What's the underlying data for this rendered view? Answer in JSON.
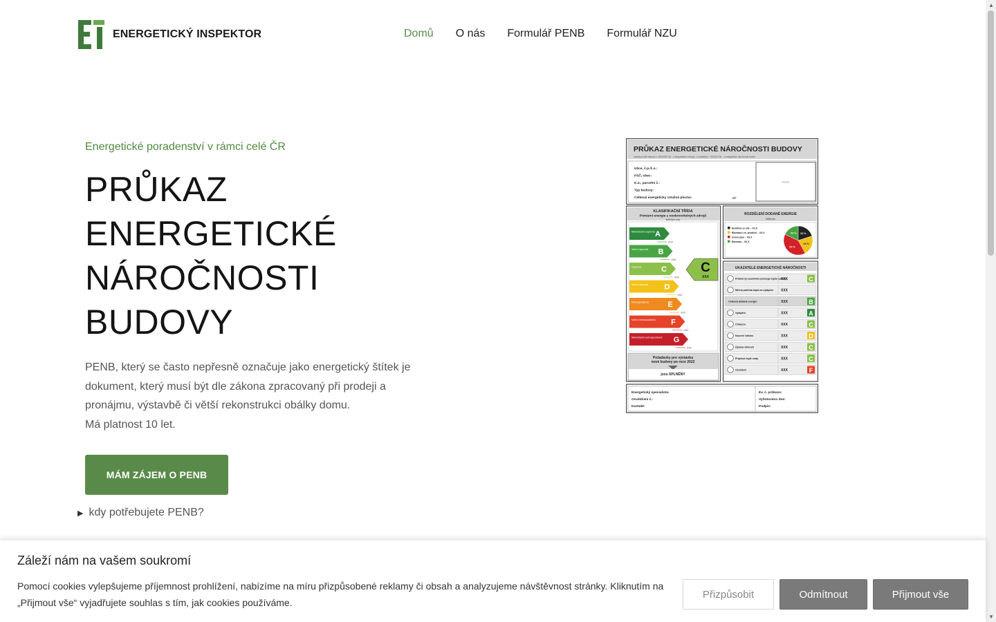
{
  "header": {
    "logo_text": "ENERGETICKÝ INSPEKTOR",
    "nav": [
      {
        "label": "Domů",
        "active": true
      },
      {
        "label": "O nás",
        "active": false
      },
      {
        "label": "Formulář PENB",
        "active": false
      },
      {
        "label": "Formulář NZU",
        "active": false
      }
    ]
  },
  "hero": {
    "kicker": "Energetické poradenství v rámci celé ČR",
    "title_lines": [
      "PRŮKAZ",
      "ENERGETICKÉ",
      "NÁROČNOSTI",
      "BUDOVY"
    ],
    "desc_lines": [
      "PENB, který se často nepřesně označuje jako energetický štítek je",
      "dokument, který musí být dle zákona zpracovaný při prodeji a",
      "pronájmu, výstavbě či větší rekonstrukci obálky domu.",
      "Má platnost 10 let."
    ],
    "cta_label": "MÁM ZÁJEM O PENB",
    "details_label": "kdy potřebujete PENB?"
  },
  "certificate": {
    "title": "PRŮKAZ ENERGETICKÉ NÁROČNOSTI BUDOVY",
    "subtitle": "vydaný podle zákona č. 406/2000 Sb., o hospodaření energií, a vyhlášky č. 78/2013 Sb., o energetické náročnosti budov",
    "fields": [
      "Ulice, č.p./č.o.:",
      "PSČ, obec:",
      "K.ú., parcelní č.:",
      "Typ budovy:",
      "Celková energeticky vztažná plocha:"
    ],
    "area_unit": "m²",
    "photo_label": "FOTO",
    "class_title": "KLASIFIKAČNÍ TŘÍDA",
    "class_subtitle": "Primární energie z neobnovitelných zdrojů",
    "class_unit": "kWh/(m²·rok)",
    "classes": [
      {
        "letter": "A",
        "label": "Mimořádně úsporná",
        "color": "#2e8b3e"
      },
      {
        "letter": "B",
        "label": "Velmi úsporná",
        "color": "#49a544"
      },
      {
        "letter": "C",
        "label": "Úsporná",
        "color": "#8cc04a"
      },
      {
        "letter": "D",
        "label": "Méně úsporná",
        "color": "#f2c21b"
      },
      {
        "letter": "E",
        "label": "Nehospodárná",
        "color": "#ef8a1f"
      },
      {
        "letter": "F",
        "label": "Velmi nehospodárná",
        "color": "#e5432a"
      },
      {
        "letter": "G",
        "label": "Mimořádně nehospodárná",
        "color": "#c5202a"
      }
    ],
    "placeholder": "XXX",
    "current_class": "C",
    "current_value": "XXX",
    "requirement_text_1": "Požadavky pro výstavbu",
    "requirement_text_2": "nové budovy po roce 2022",
    "requirement_text_3": "jsou SPLNĚNY",
    "energy_title": "ROZDĚLENÍ DODANÉ ENERGIE",
    "energy_unit": "MWh/rok",
    "energy_items": [
      {
        "label": "Elektřina ze sítě – XX,X",
        "color": "#222222"
      },
      {
        "label": "Biomasa z.m. prodlení – XX,X",
        "color": "#f2c21b"
      },
      {
        "label": "Zemní plyn – XX,X",
        "color": "#d42027"
      },
      {
        "label": "Biomasa – XX,X",
        "color": "#49a544"
      }
    ],
    "pie_labels": [
      "XX %",
      "XX %",
      "XX %",
      "XX %"
    ],
    "indicators_title": "UKAZATELE ENERGETICKÉ NÁROČNOSTI",
    "indicators": [
      {
        "label": "Průměrný součinitel prostupu tepla budovy",
        "value": "XXX",
        "class": "C",
        "color": "#8cc04a"
      },
      {
        "label": "Měrná potřeba tepla na vytápění",
        "value": "XXX",
        "class": "",
        "color": ""
      },
      {
        "label": "Celková dodaná energie",
        "value": "XXX",
        "class": "B",
        "color": "#49a544"
      },
      {
        "label": "Vytápění",
        "value": "XXX",
        "class": "A",
        "color": "#2e8b3e"
      },
      {
        "label": "Chlazení",
        "value": "XXX",
        "class": "C",
        "color": "#8cc04a"
      },
      {
        "label": "Nucené větrání",
        "value": "XXX",
        "class": "D",
        "color": "#f2c21b"
      },
      {
        "label": "Úprava vlhkosti",
        "value": "XXX",
        "class": "C",
        "color": "#8cc04a"
      },
      {
        "label": "Příprava teplé vody",
        "value": "XXX",
        "class": "C",
        "color": "#8cc04a"
      },
      {
        "label": "Osvětlení",
        "value": "XXX",
        "class": "F",
        "color": "#e5432a"
      }
    ],
    "footer_left": [
      "Energetický specialista:",
      "Osvědčení č.:",
      "Kontakt:"
    ],
    "footer_right": [
      "Ev. č. průkazu:",
      "Vyhotoveno dne:",
      "Podpis:"
    ]
  },
  "cookie": {
    "title": "Záleží nám na vašem soukromí",
    "text": "Pomocí cookies vylepšujeme příjemnost prohlížení, nabízíme na míru přizpůsobené reklamy či obsah a analyzujeme návštěvnost stránky. Kliknutím na „Přijmout vše“ vyjadřujete souhlas s tím, jak cookies používáme.",
    "customize": "Přizpůsobit",
    "reject": "Odmítnout",
    "accept": "Přijmout vše"
  },
  "colors": {
    "accent": "#5a8a4a",
    "kicker": "#4f8a3f"
  }
}
